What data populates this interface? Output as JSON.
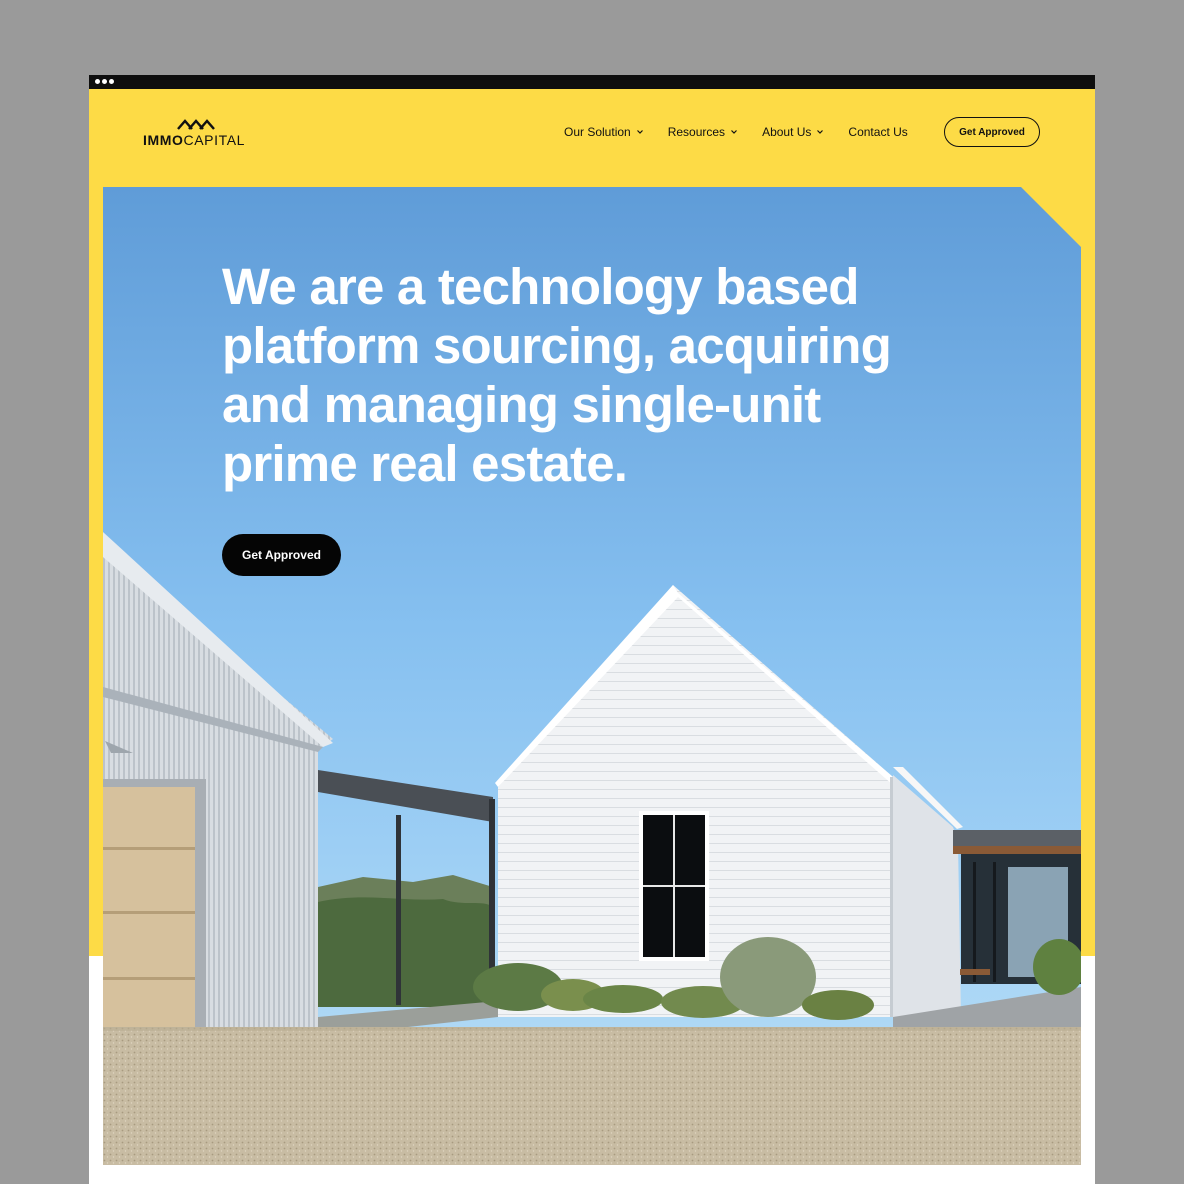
{
  "brand": {
    "logo_bold": "IMMO",
    "logo_light": "CAPITAL"
  },
  "nav": {
    "items": [
      {
        "label": "Our Solution",
        "has_dropdown": true
      },
      {
        "label": "Resources",
        "has_dropdown": true
      },
      {
        "label": "About Us",
        "has_dropdown": true
      },
      {
        "label": "Contact Us",
        "has_dropdown": false
      }
    ],
    "cta_label": "Get Approved"
  },
  "hero": {
    "headline": "We are a technology based platform sourcing, acquiring and managing single-unit prime real estate.",
    "cta_label": "Get Approved"
  },
  "colors": {
    "brand_yellow": "#fddb46",
    "button_black": "#050505",
    "sky_top": "#5f9cd8",
    "sky_bottom": "#a9d6f6"
  }
}
